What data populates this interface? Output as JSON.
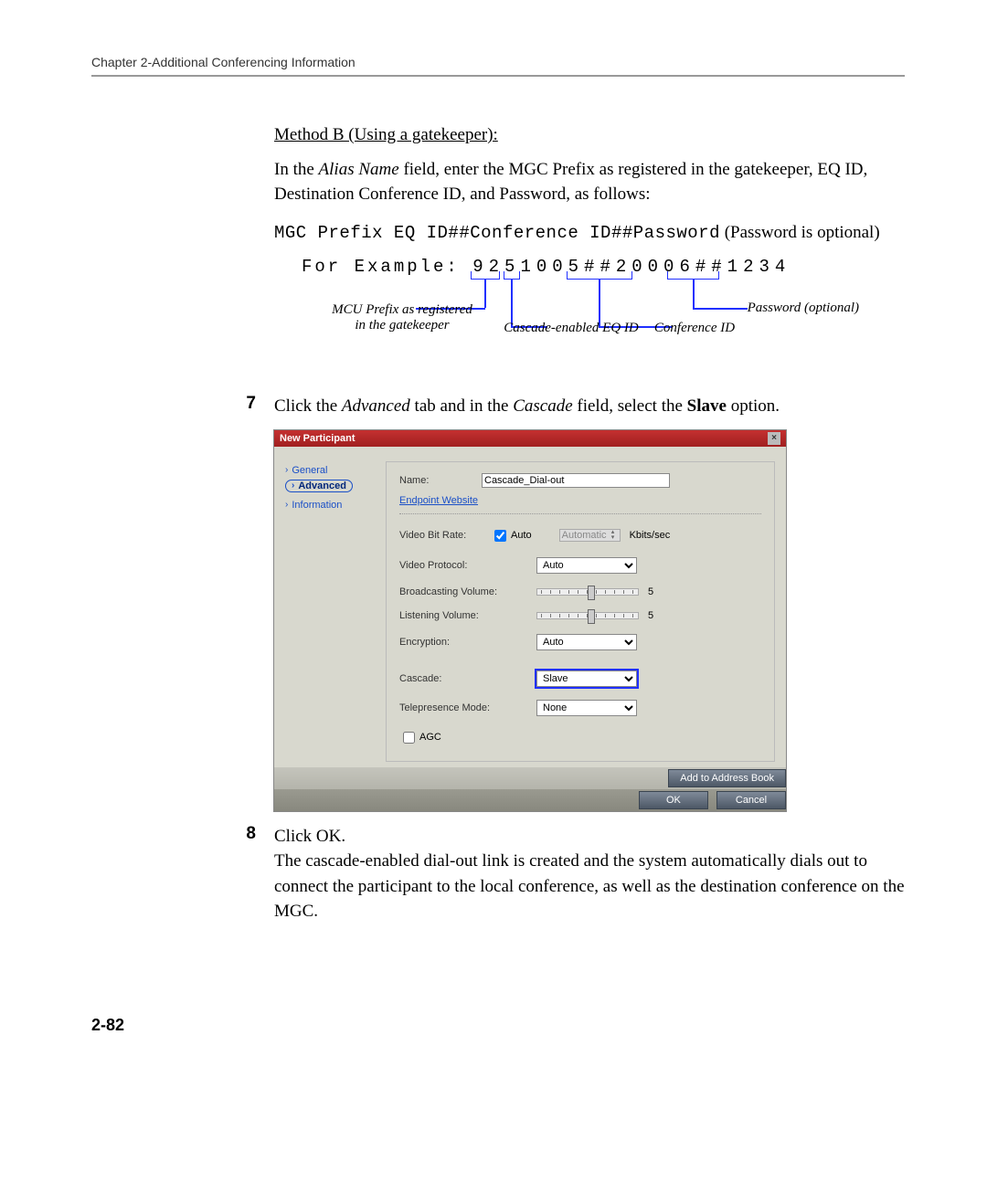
{
  "header": {
    "chapter": "Chapter 2-Additional Conferencing Information"
  },
  "method_b": {
    "title": "Method B (Using a gatekeeper):",
    "intro_pre": "In the ",
    "intro_italic": "Alias Name",
    "intro_post": " field, enter the MGC Prefix as registered in the gatekeeper, EQ ID, Destination Conference ID, and Password, as follows:",
    "code": "MGC Prefix EQ ID##Conference ID##Password",
    "code_tail": " (Password is optional)",
    "example_label": "For Example: ",
    "example_value": "9251005##20006##1234"
  },
  "diagram_labels": {
    "mcu_prefix": "MCU Prefix as registered in the gatekeeper",
    "cascade_eq": "Cascade-enabled EQ ID",
    "conf_id": "Conference ID",
    "password": "Password (optional)"
  },
  "step7": {
    "num": "7",
    "pre": "Click the ",
    "italic1": "Advanced",
    "mid": " tab and in the ",
    "italic2": "Cascade",
    "post": " field, select the ",
    "bold": "Slave",
    "tail": " option."
  },
  "dialog": {
    "title": "New Participant",
    "nav": {
      "general": "General",
      "advanced": "Advanced",
      "information": "Information"
    },
    "name_label": "Name:",
    "name_value": "Cascade_Dial-out",
    "endpoint_link": "Endpoint Website",
    "video_bit_label": "Video Bit Rate:",
    "auto_checkbox": "Auto",
    "auto_display": "Automatic",
    "kbits": "Kbits/sec",
    "video_protocol_label": "Video Protocol:",
    "video_protocol_value": "Auto",
    "broadcasting_label": "Broadcasting Volume:",
    "broadcasting_value": "5",
    "listening_label": "Listening Volume:",
    "listening_value": "5",
    "encryption_label": "Encryption:",
    "encryption_value": "Auto",
    "cascade_label": "Cascade:",
    "cascade_value": "Slave",
    "telepresence_label": "Telepresence Mode:",
    "telepresence_value": "None",
    "agc_label": "AGC",
    "add_book": "Add to Address Book",
    "ok": "OK",
    "cancel": "Cancel"
  },
  "step8": {
    "num": "8",
    "line1": "Click OK.",
    "para": "The cascade-enabled dial-out link is created and the system automatically dials out to connect the participant to the local conference, as well as the destination conference on the MGC."
  },
  "page_number": "2-82"
}
